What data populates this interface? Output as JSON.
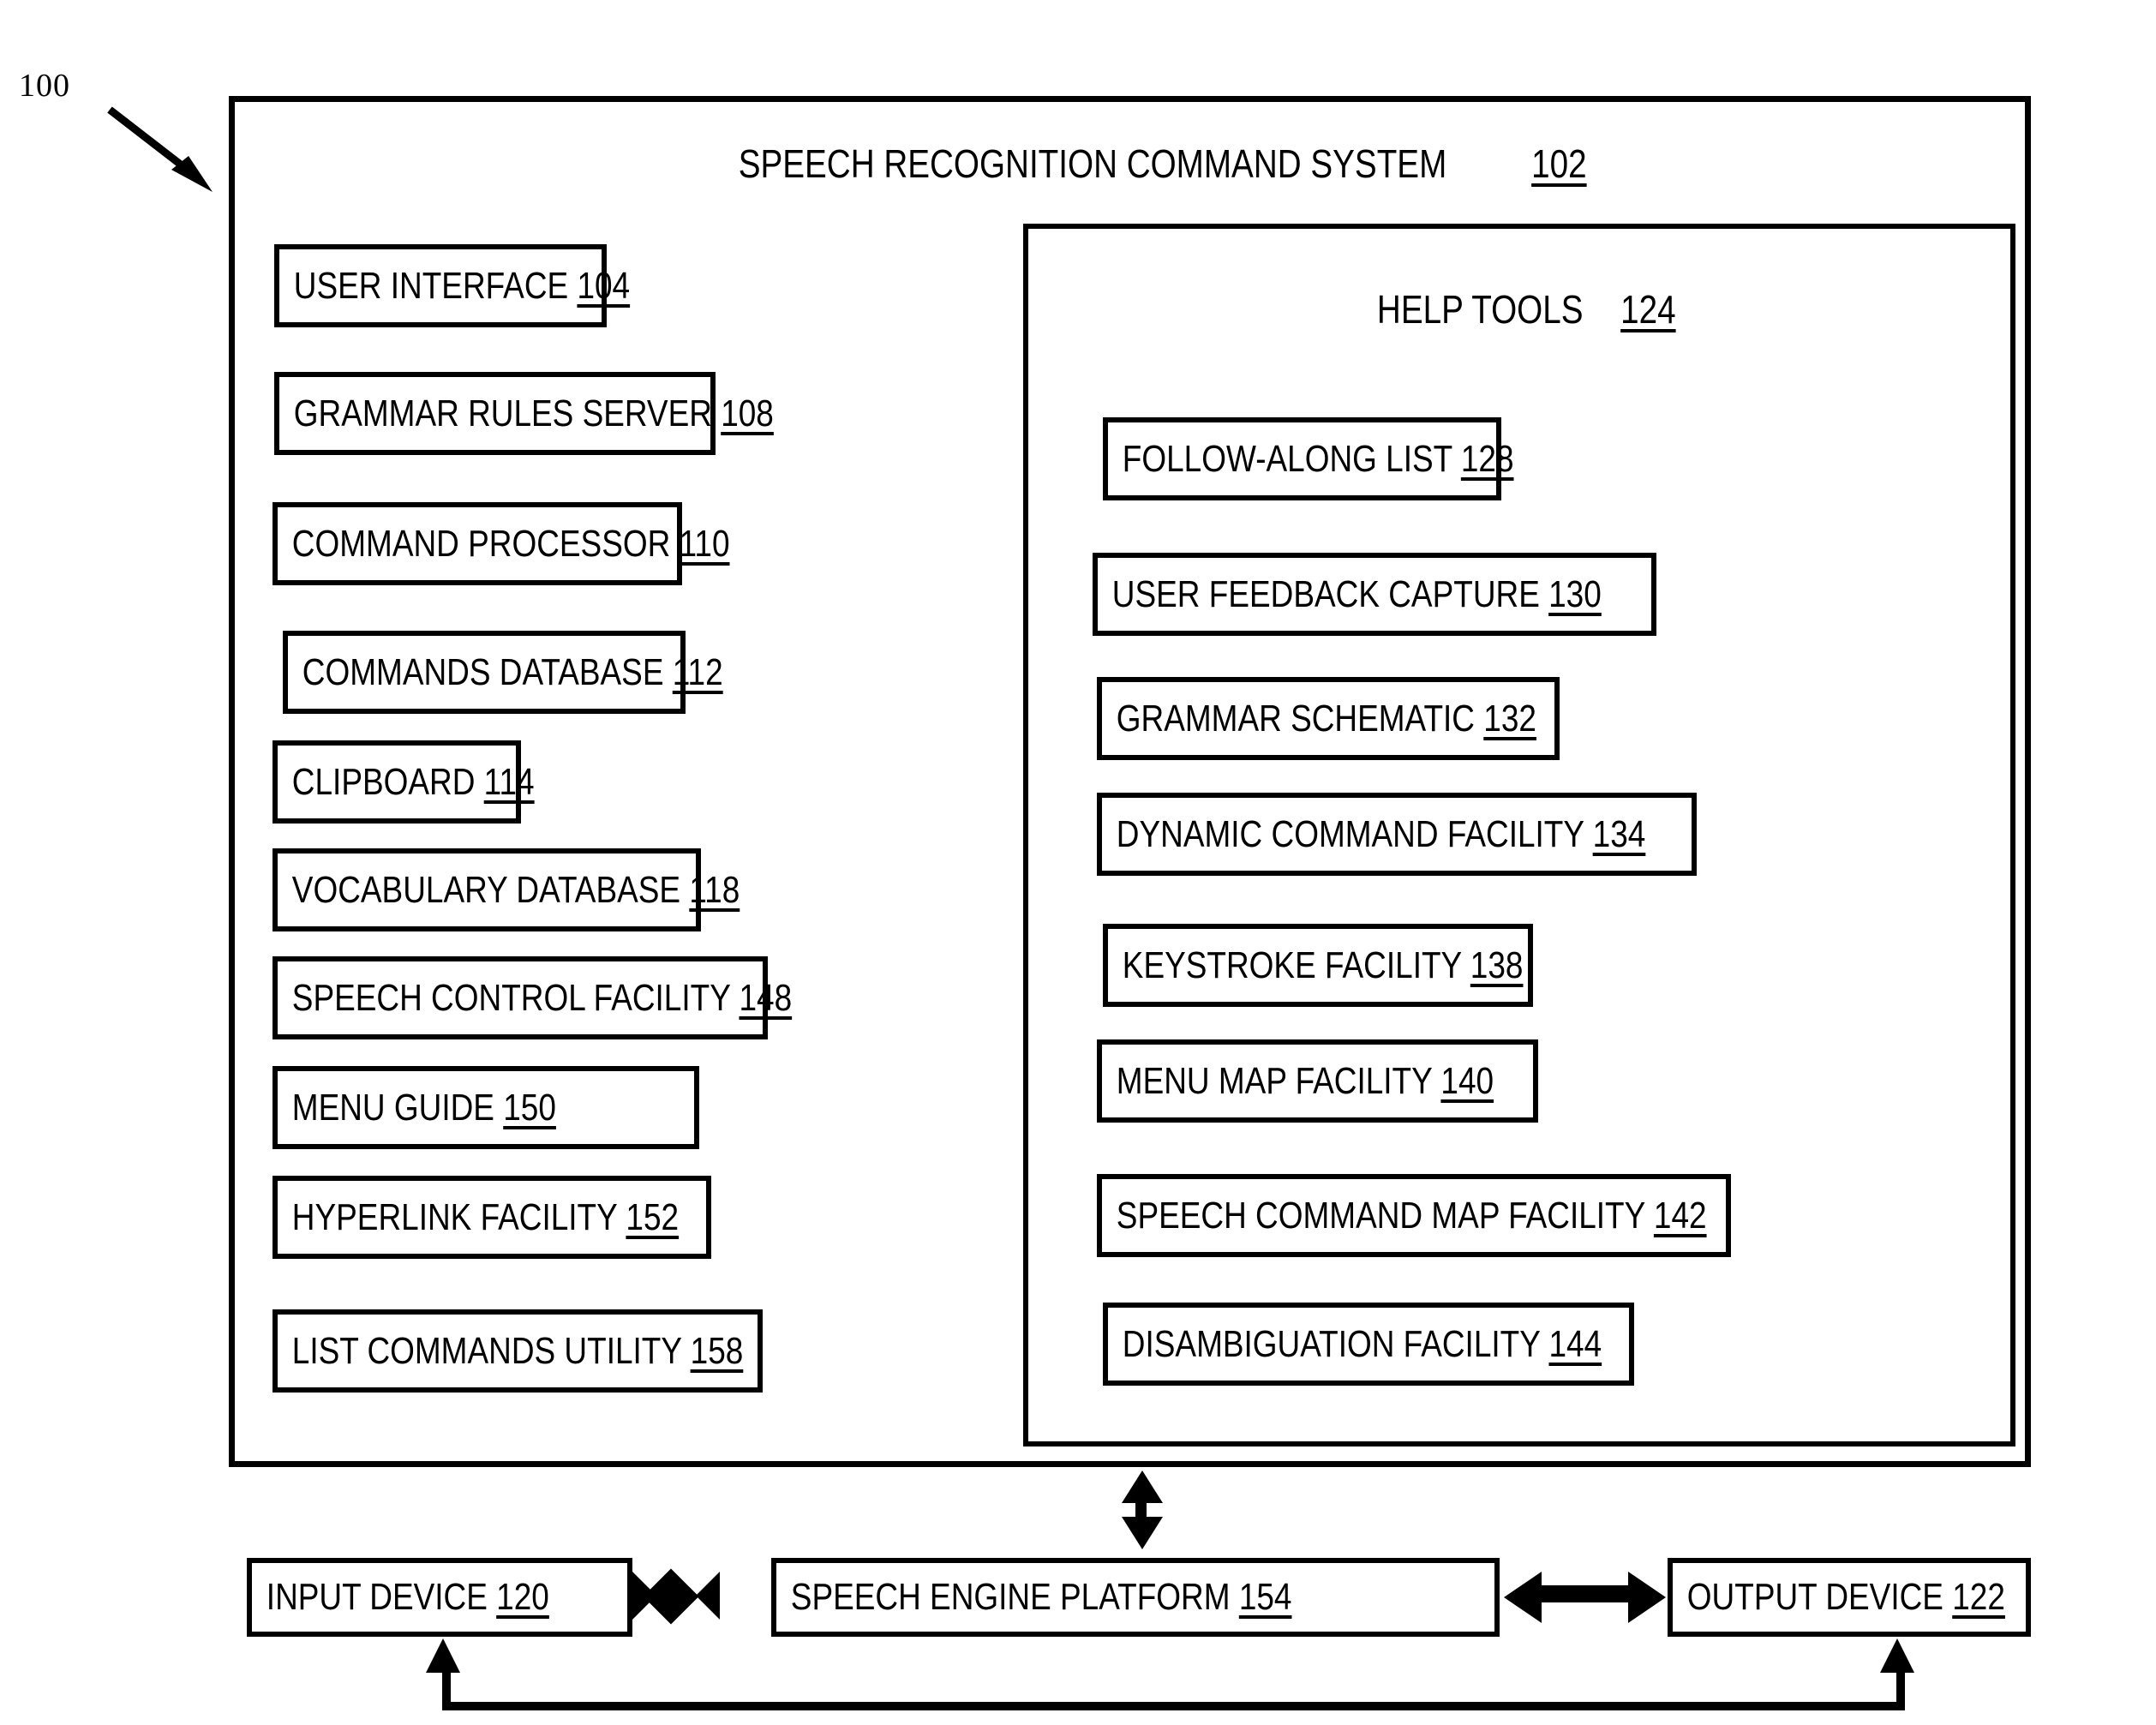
{
  "figure": {
    "callout_number": "100"
  },
  "system": {
    "title_text": "SPEECH RECOGNITION COMMAND SYSTEM",
    "title_number": "102"
  },
  "left_column": {
    "items": [
      {
        "label": "USER INTERFACE",
        "number": "104"
      },
      {
        "label": "GRAMMAR RULES SERVER",
        "number": "108"
      },
      {
        "label": "COMMAND PROCESSOR",
        "number": "110"
      },
      {
        "label": "COMMANDS DATABASE",
        "number": "112"
      },
      {
        "label": "CLIPBOARD",
        "number": "114"
      },
      {
        "label": "VOCABULARY DATABASE",
        "number": "118"
      },
      {
        "label": "SPEECH CONTROL FACILITY",
        "number": "148"
      },
      {
        "label": "MENU GUIDE",
        "number": "150"
      },
      {
        "label": "HYPERLINK FACILITY",
        "number": "152"
      },
      {
        "label": "LIST COMMANDS UTILITY",
        "number": "158"
      }
    ]
  },
  "help_tools": {
    "title_text": "HELP TOOLS",
    "title_number": "124",
    "items": [
      {
        "label": "FOLLOW-ALONG LIST",
        "number": "128"
      },
      {
        "label": "USER FEEDBACK CAPTURE",
        "number": "130"
      },
      {
        "label": "GRAMMAR SCHEMATIC",
        "number": "132"
      },
      {
        "label": "DYNAMIC COMMAND FACILITY",
        "number": "134"
      },
      {
        "label": "KEYSTROKE FACILITY",
        "number": "138"
      },
      {
        "label": "MENU MAP FACILITY",
        "number": "140"
      },
      {
        "label": "SPEECH COMMAND MAP FACILITY",
        "number": "142"
      },
      {
        "label": "DISAMBIGUATION FACILITY",
        "number": "144"
      }
    ]
  },
  "bottom_row": {
    "input_device": {
      "label": "INPUT DEVICE",
      "number": "120"
    },
    "speech_engine": {
      "label": "SPEECH ENGINE PLATFORM",
      "number": "154"
    },
    "output_device": {
      "label": "OUTPUT DEVICE",
      "number": "122"
    }
  },
  "colors": {
    "stroke": "#000000",
    "background": "#ffffff"
  }
}
